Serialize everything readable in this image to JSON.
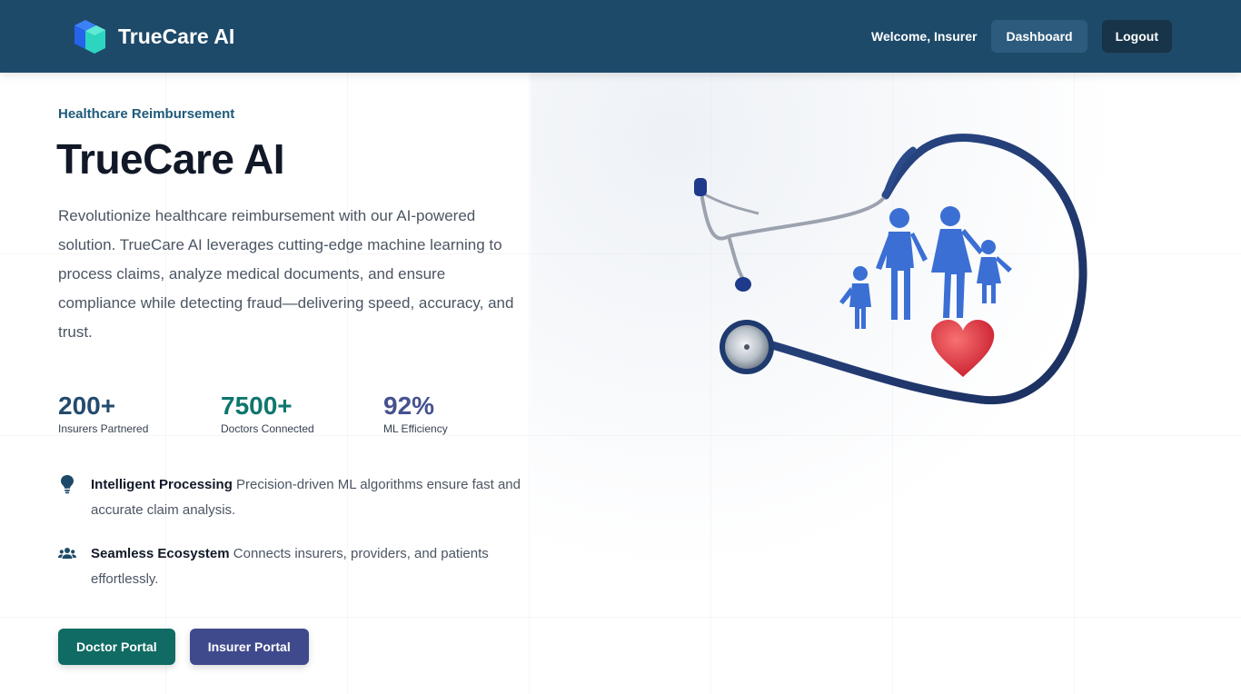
{
  "colors": {
    "navbar_bg": "#1e4a6a",
    "dashboard_button_bg": "#2c5b7e",
    "logout_button_bg": "#183449",
    "eyebrow_text": "#1e5a7a",
    "stat_insurers": "#234b6e",
    "stat_doctors": "#0f766e",
    "stat_efficiency": "#46528f",
    "doctor_portal_bg": "#0f6b63",
    "insurer_portal_bg": "#3f4a8c"
  },
  "navbar": {
    "brand_name": "TrueCare AI",
    "logo_icon": "cube-logo-icon",
    "welcome_text": "Welcome, Insurer",
    "dashboard_label": "Dashboard",
    "logout_label": "Logout"
  },
  "hero": {
    "eyebrow": "Healthcare Reimbursement",
    "title": "TrueCare AI",
    "description": "Revolutionize healthcare reimbursement with our AI-powered solution. TrueCare AI leverages cutting-edge machine learning to process claims, analyze medical documents, and ensure compliance while detecting fraud—delivering speed, accuracy, and trust.",
    "illustration_icon": "stethoscope-family-heart-icon"
  },
  "stats": [
    {
      "value": "200+",
      "label": "Insurers Partnered"
    },
    {
      "value": "7500+",
      "label": "Doctors Connected"
    },
    {
      "value": "92%",
      "label": "ML Efficiency"
    }
  ],
  "features": [
    {
      "icon": "lightbulb-icon",
      "title": "Intelligent Processing",
      "text": "Precision-driven ML algorithms ensure fast and accurate claim analysis."
    },
    {
      "icon": "users-icon",
      "title": "Seamless Ecosystem",
      "text": "Connects insurers, providers, and patients effortlessly."
    }
  ],
  "cta": {
    "doctor_label": "Doctor Portal",
    "insurer_label": "Insurer Portal"
  }
}
